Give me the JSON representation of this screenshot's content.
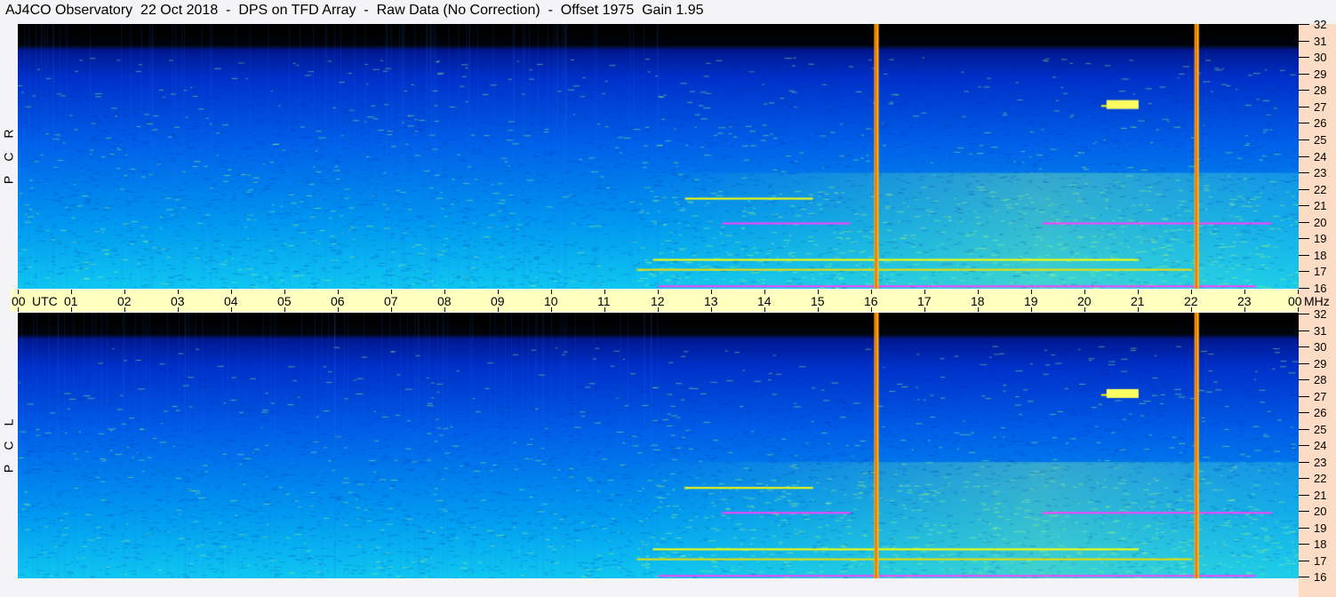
{
  "title": "AJ4CO Observatory  22 Oct 2018  -  DPS on TFD Array  -  Raw Data (No Correction)  -  Offset 1975  Gain 1.95",
  "chart_data": {
    "type": "heatmap",
    "title": "AJ4CO Observatory  22 Oct 2018  -  DPS on TFD Array  -  Raw Data (No Correction)  -  Offset 1975  Gain 1.95",
    "xlabel": "UTC",
    "ylabel": "MHz",
    "x_ticks": [
      "00",
      "01",
      "02",
      "03",
      "04",
      "05",
      "06",
      "07",
      "08",
      "09",
      "10",
      "11",
      "12",
      "13",
      "14",
      "15",
      "16",
      "17",
      "18",
      "19",
      "20",
      "21",
      "22",
      "23",
      "00"
    ],
    "y_ticks": [
      32,
      31,
      30,
      29,
      28,
      27,
      26,
      25,
      24,
      23,
      22,
      21,
      20,
      19,
      18,
      17,
      16
    ],
    "xlim_hours": [
      0,
      24
    ],
    "ylim_mhz": [
      16,
      32
    ],
    "panels": [
      {
        "label": "R C P"
      },
      {
        "label": "L C P"
      }
    ],
    "colormap": [
      "#000000",
      "#00109a",
      "#0040e0",
      "#0090f0",
      "#20d0e0",
      "#a0f070",
      "#ffff00",
      "#ff40ff"
    ],
    "vertical_markers_utc": [
      16.08,
      22.08
    ],
    "marker_color": "#ff6000",
    "notable_emissions": [
      {
        "mhz": 20.0,
        "from": 13.2,
        "to": 15.6,
        "color": "#ff40ff"
      },
      {
        "mhz": 20.0,
        "from": 19.2,
        "to": 23.5,
        "color": "#ff40ff"
      },
      {
        "mhz": 21.5,
        "from": 12.5,
        "to": 14.9,
        "color": "#ffff00"
      },
      {
        "mhz": 17.8,
        "from": 11.9,
        "to": 21.0,
        "color": "#ffff00"
      },
      {
        "mhz": 17.2,
        "from": 11.6,
        "to": 22.0,
        "color": "#f0e000"
      },
      {
        "mhz": 16.2,
        "from": 12.0,
        "to": 23.2,
        "color": "#ff40ff"
      },
      {
        "mhz": 27.1,
        "from": 20.3,
        "to": 21.0,
        "color": "#ffff00"
      }
    ]
  },
  "axis": {
    "utc_label": "UTC",
    "mhz_label": "MHz"
  }
}
